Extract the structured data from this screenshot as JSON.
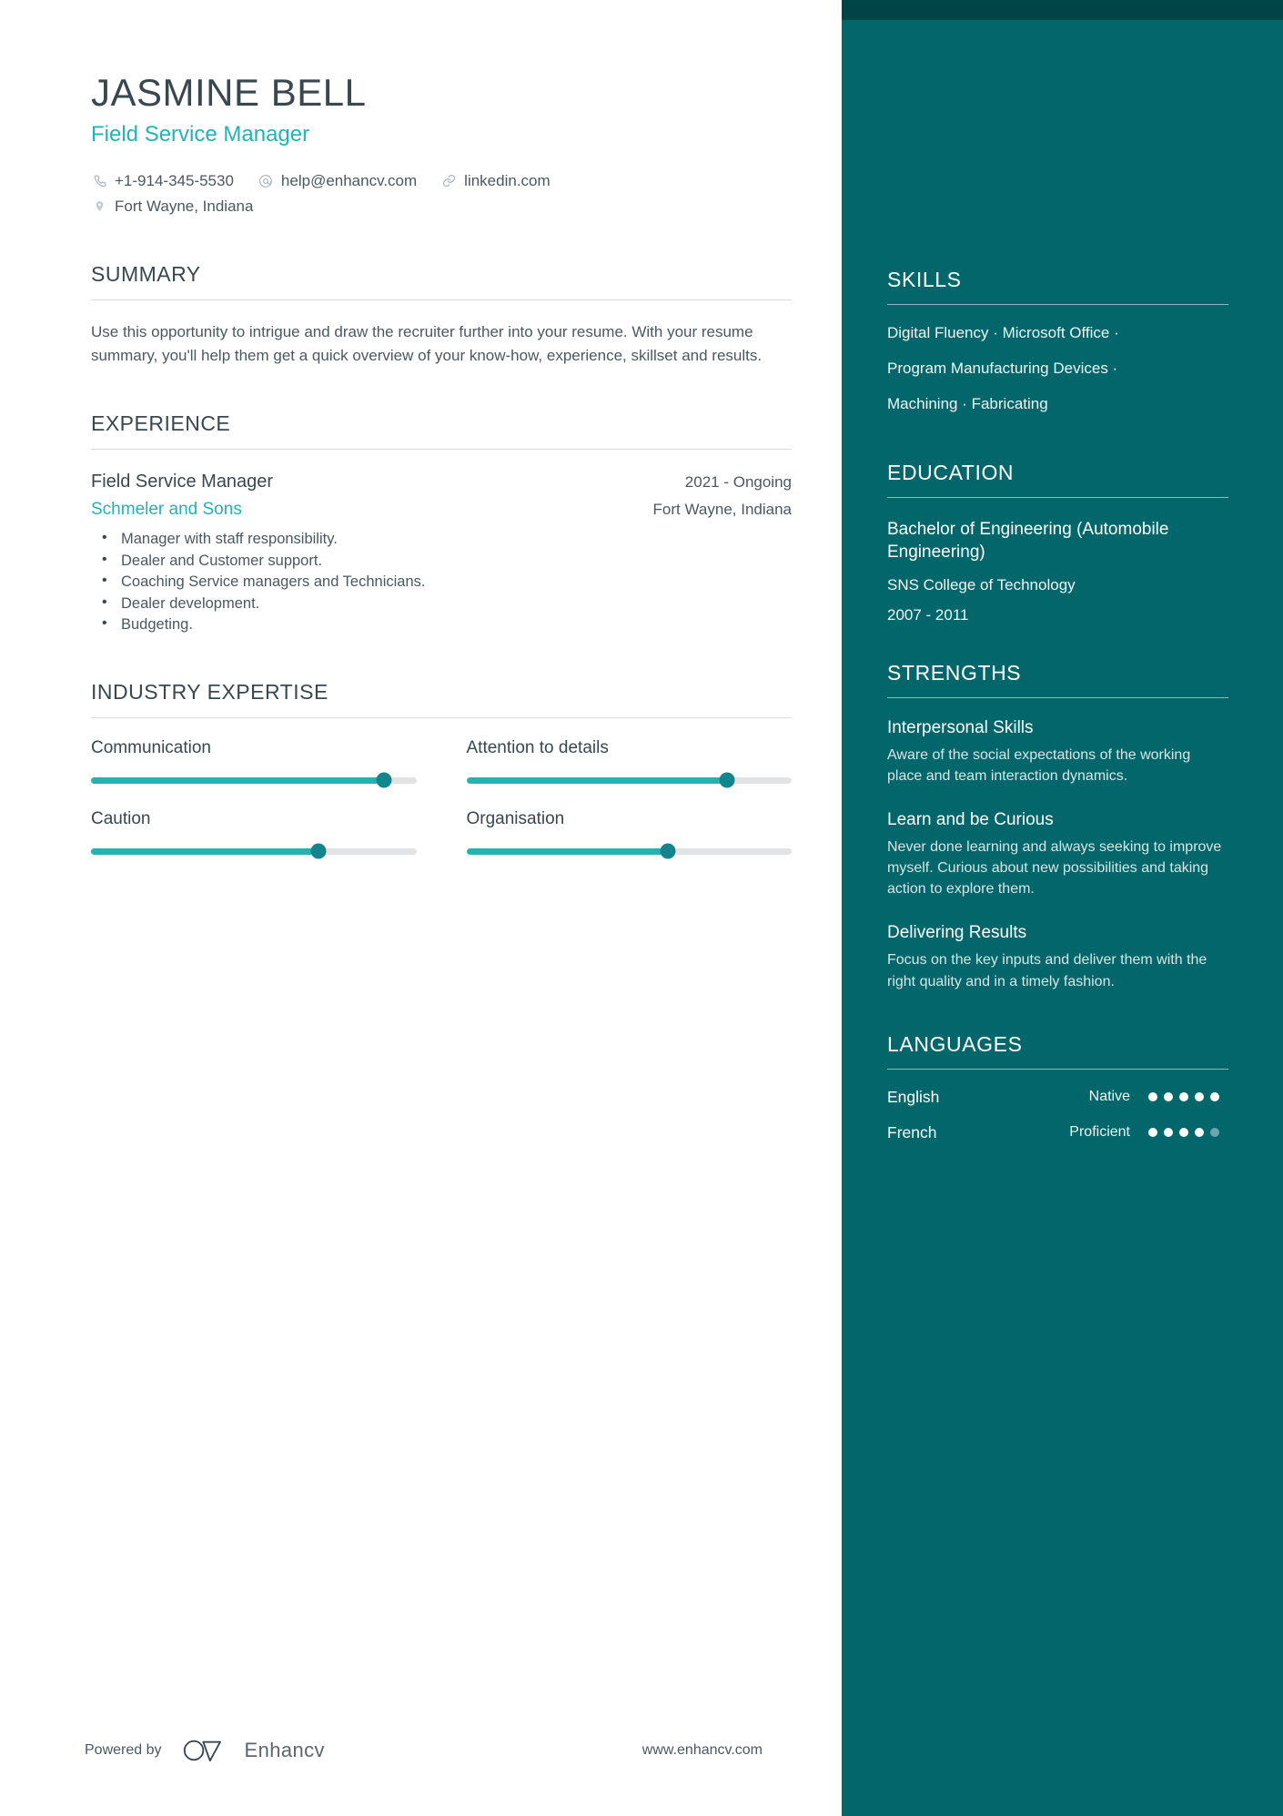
{
  "theme": {
    "accent_teal": "#21b3b8",
    "sidebar_bg": "#03666b",
    "sidebar_topbar": "#014447",
    "slider_fill": "#27b2b2",
    "slider_knob": "#12868c",
    "heading_color": "#39474f"
  },
  "header": {
    "name": "JASMINE BELL",
    "job_title": "Field Service Manager",
    "contacts": {
      "phone": "+1-914-345-5530",
      "email": "help@enhancv.com",
      "link": "linkedin.com",
      "location": "Fort Wayne, Indiana"
    }
  },
  "summary": {
    "title": "SUMMARY",
    "text": "Use this opportunity to intrigue and draw the recruiter further into your resume. With your resume summary, you'll help them get a quick overview of your know-how, experience, skillset and results."
  },
  "experience": {
    "title": "EXPERIENCE",
    "entries": [
      {
        "role": "Field Service Manager",
        "date": "2021 - Ongoing",
        "company": "Schmeler and Sons",
        "location": "Fort Wayne, Indiana",
        "bullets": [
          "Manager with staff responsibility.",
          "Dealer and Customer support.",
          "Coaching Service managers and Technicians.",
          "Dealer development.",
          "Budgeting."
        ]
      }
    ]
  },
  "industry_expertise": {
    "title": "INDUSTRY EXPERTISE",
    "items": [
      {
        "label": "Communication",
        "value": 90
      },
      {
        "label": "Attention to details",
        "value": 80
      },
      {
        "label": "Caution",
        "value": 70
      },
      {
        "label": "Organisation",
        "value": 62
      }
    ]
  },
  "sidebar": {
    "skills": {
      "title": "SKILLS",
      "lines": [
        "Digital Fluency · Microsoft Office ·",
        "Program Manufacturing Devices ·",
        "Machining · Fabricating"
      ]
    },
    "education": {
      "title": "EDUCATION",
      "degree": "Bachelor of Engineering (Automobile Engineering)",
      "school": "SNS College of Technology",
      "date": "2007 - 2011"
    },
    "strengths": {
      "title": "STRENGTHS",
      "items": [
        {
          "name": "Interpersonal Skills",
          "desc": "Aware of the social expectations of the working place and team interaction dynamics."
        },
        {
          "name": "Learn and be Curious",
          "desc": "Never done learning and always seeking to improve myself. Curious about new possibilities and taking action to explore them."
        },
        {
          "name": "Delivering Results",
          "desc": "Focus on the key inputs and deliver them with the right quality and in a timely fashion."
        }
      ]
    },
    "languages": {
      "title": "LANGUAGES",
      "items": [
        {
          "name": "English",
          "level": "Native",
          "dots_filled": 5,
          "dots_total": 5
        },
        {
          "name": "French",
          "level": "Proficient",
          "dots_filled": 4,
          "dots_total": 5
        }
      ]
    }
  },
  "footer": {
    "powered_by": "Powered by",
    "brand": "Enhancv",
    "url": "www.enhancv.com"
  }
}
